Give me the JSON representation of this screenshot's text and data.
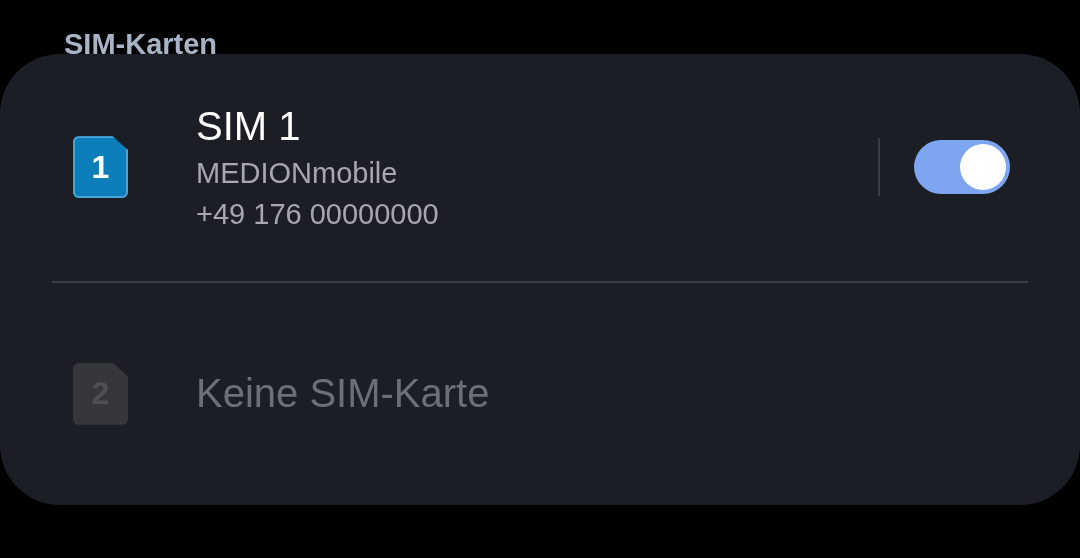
{
  "section_title": "SIM-Karten",
  "sims": [
    {
      "kind": "inserted",
      "number": "1",
      "name": "SIM 1",
      "carrier": "MEDIONmobile",
      "phone": "+49 176 00000000",
      "on": true
    },
    {
      "kind": "empty",
      "number": "2",
      "name": "Keine SIM-Karte"
    }
  ]
}
